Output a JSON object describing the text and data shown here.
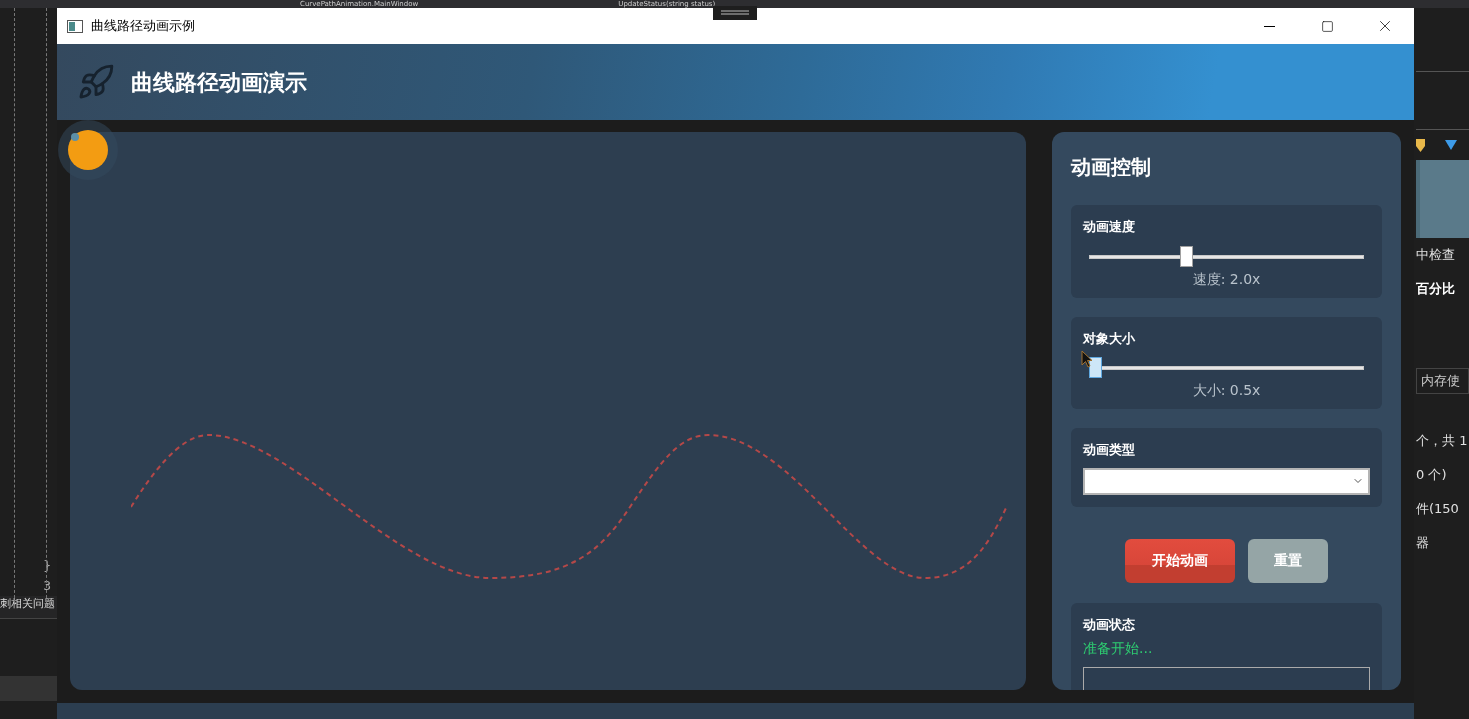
{
  "ide": {
    "top_tabs": [
      "CurvePathAnimation.MainWindow",
      "UpdateStatus(string status)"
    ],
    "left_lines": [
      "}",
      "3"
    ],
    "left_label": "刺相关问题",
    "right_texts": [
      {
        "kind": "text",
        "text": "中检查"
      },
      {
        "kind": "bold",
        "text": "百分比"
      },
      {
        "kind": "tab",
        "text": "内存使"
      },
      {
        "kind": "text",
        "text": "个，共 1"
      },
      {
        "kind": "text",
        "text": "0 个)"
      },
      {
        "kind": "text",
        "text": "件(150"
      },
      {
        "kind": "text",
        "text": "器"
      }
    ]
  },
  "window": {
    "title": "曲线路径动画示例"
  },
  "header": {
    "title": "曲线路径动画演示"
  },
  "controls": {
    "title": "动画控制",
    "sliders": [
      {
        "label": "动画速度",
        "level": 0.33,
        "reading": "速度: 2.0x",
        "hovered": false
      },
      {
        "label": "对象大小",
        "level": 0,
        "reading": "大小: 0.5x",
        "hovered": true
      }
    ],
    "type_select": {
      "label": "动画类型"
    },
    "buttons": [
      {
        "label": "开始动画",
        "kind": "primary"
      },
      {
        "label": "重置",
        "kind": "secondary"
      }
    ],
    "status": {
      "label": "动画状态",
      "message": "准备开始..."
    }
  }
}
